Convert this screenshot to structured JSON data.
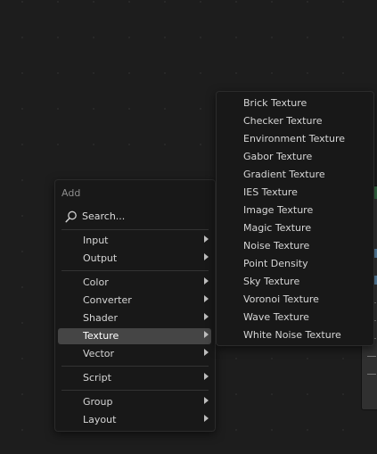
{
  "add_menu": {
    "title": "Add",
    "search_label": "Search...",
    "groups": [
      [
        "Input",
        "Output"
      ],
      [
        "Color",
        "Converter",
        "Shader",
        "Texture",
        "Vector"
      ],
      [
        "Script"
      ],
      [
        "Group",
        "Layout"
      ]
    ],
    "active_item": "Texture"
  },
  "texture_submenu": {
    "items": [
      "Brick Texture",
      "Checker Texture",
      "Environment Texture",
      "Gabor Texture",
      "Gradient Texture",
      "IES Texture",
      "Image Texture",
      "Magic Texture",
      "Noise Texture",
      "Point Density",
      "Sky Texture",
      "Voronoi Texture",
      "Wave Texture",
      "White Noise Texture"
    ]
  },
  "colors": {
    "canvas": "#1d1d1d",
    "menu_bg": "#181818",
    "highlight": "#454545",
    "node_header": "#356b43",
    "socket": "#5a86a8"
  },
  "icons": {
    "search": "magnifier-icon",
    "submenu_arrow": "triangle-right-icon"
  }
}
